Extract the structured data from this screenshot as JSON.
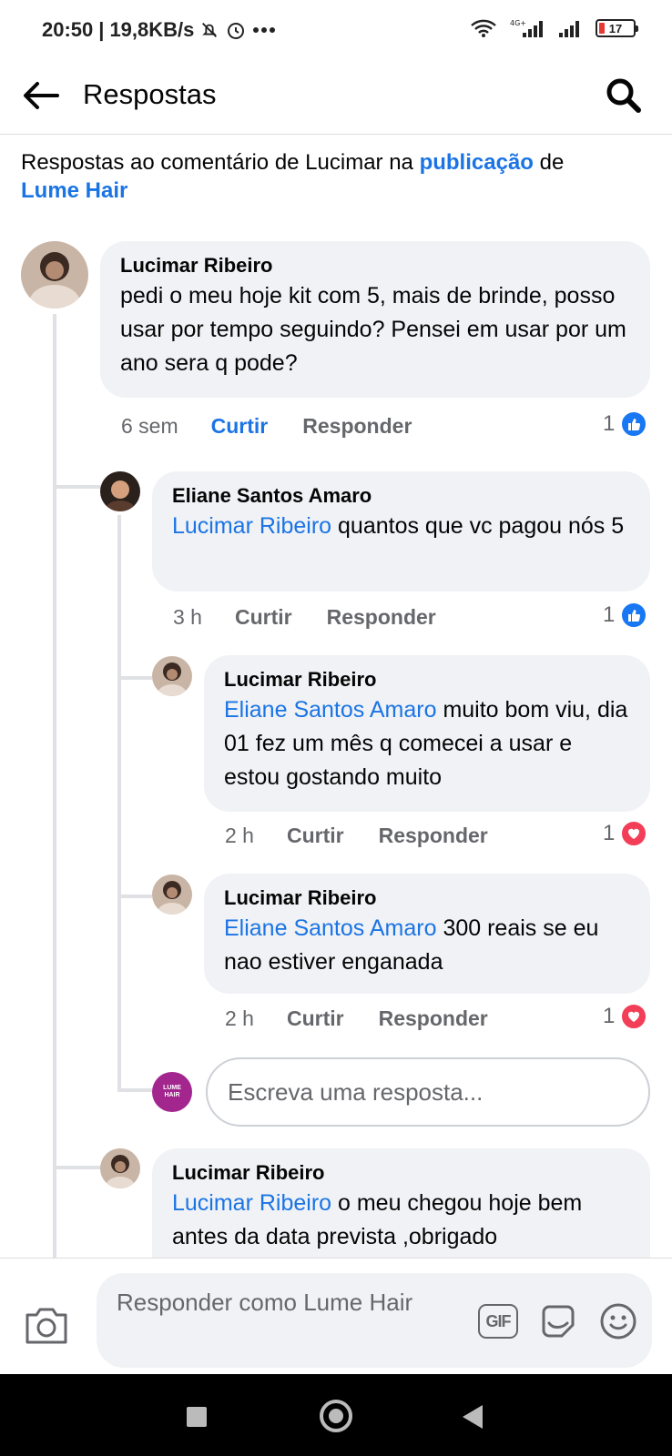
{
  "status_bar": {
    "time": "20:50",
    "speed": "19,8KB/s",
    "battery": "17"
  },
  "header": {
    "title": "Respostas",
    "back_icon": "arrow-left-icon",
    "search_icon": "search-icon"
  },
  "context": {
    "prefix": "Respostas ao comentário de Lucimar na",
    "link_post": "publicação",
    "middle": "de",
    "link_page": "Lume Hair"
  },
  "comments": [
    {
      "author": "Lucimar Ribeiro",
      "mention": "",
      "text": "pedi o meu hoje kit com 5,  mais  de brinde, posso usar por  tempo seguindo? Pensei em usar por um ano sera q pode?",
      "time": "6 sem",
      "like_label": "Curtir",
      "reply_label": "Responder",
      "reaction_count": "1",
      "reaction": "like"
    },
    {
      "author": "Eliane Santos Amaro",
      "mention": "Lucimar Ribeiro",
      "text": "quantos que vc pagou nós 5",
      "time": "3 h",
      "like_label": "Curtir",
      "reply_label": "Responder",
      "reaction_count": "1",
      "reaction": "like"
    },
    {
      "author": "Lucimar Ribeiro",
      "mention": "Eliane Santos Amaro",
      "text": "muito bom viu, dia 01 fez um mês q comecei a usar e estou gostando muito",
      "time": "2 h",
      "like_label": "Curtir",
      "reply_label": "Responder",
      "reaction_count": "1",
      "reaction": "love"
    },
    {
      "author": "Lucimar Ribeiro",
      "mention": "Eliane Santos Amaro",
      "text": "300 reais se eu nao estiver enganada",
      "time": "2 h",
      "like_label": "Curtir",
      "reply_label": "Responder",
      "reaction_count": "1",
      "reaction": "love"
    },
    {
      "author": "Lucimar Ribeiro",
      "mention": "Lucimar Ribeiro",
      "text": " o meu chegou hoje bem antes da data prevista ,obrigado"
    }
  ],
  "reply_input": {
    "placeholder": "Escreva uma resposta...",
    "avatar_brand": "LUME HAIR"
  },
  "composer": {
    "placeholder": "Responder como Lume Hair",
    "gif_label": "GIF"
  },
  "colors": {
    "accent": "#1b74e4",
    "bubble": "#f0f2f5",
    "love": "#f33e58",
    "brand": "#a3268f"
  }
}
